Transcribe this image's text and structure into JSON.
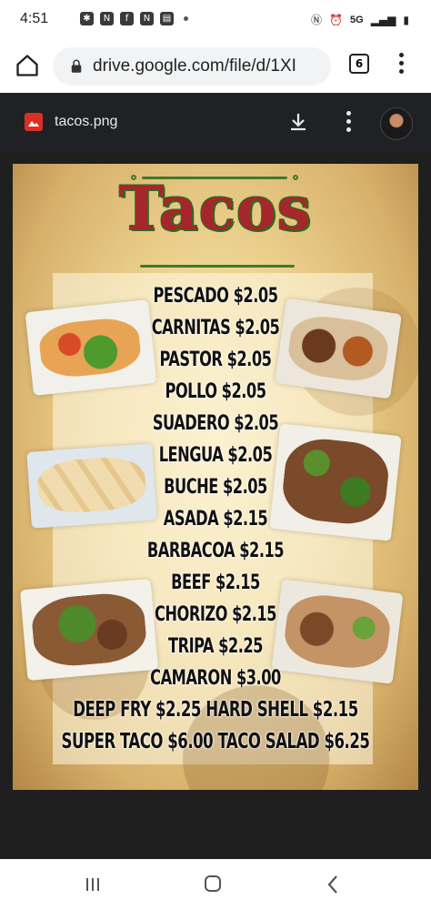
{
  "status_bar": {
    "time": "4:51",
    "network": "5G"
  },
  "browser": {
    "url": "drive.google.com/file/d/1XI",
    "tab_count": "6"
  },
  "viewer": {
    "file_name": "tacos.png"
  },
  "menu_image": {
    "title": "Tacos",
    "items": [
      "PESCADO $2.05",
      "CARNITAS $2.05",
      "PASTOR $2.05",
      "POLLO $2.05",
      "SUADERO $2.05",
      "LENGUA $2.05",
      "BUCHE $2.05",
      "ASADA $2.15",
      "BARBACOA $2.15",
      "BEEF $2.15",
      "CHORIZO $2.15",
      "TRIPA $2.25",
      "CAMARON $3.00",
      "DEEP FRY $2.25 HARD SHELL $2.15",
      "SUPER TACO $6.00 TACO SALAD $6.25"
    ]
  },
  "colors": {
    "title_red": "#a6262b",
    "title_green": "#2d6b1f",
    "viewer_bg": "#202124"
  },
  "icons": [
    "home-icon",
    "lock-icon",
    "tabs-icon",
    "menu-icon",
    "image-file-icon",
    "download-icon",
    "avatar",
    "recents-icon",
    "home-nav-icon",
    "back-icon"
  ]
}
